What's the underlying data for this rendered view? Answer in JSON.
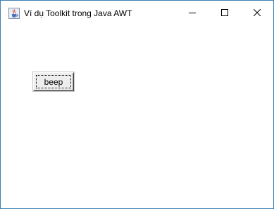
{
  "window": {
    "title": "Ví dụ Toolkit trong Java AWT",
    "icon": "java-coffee-cup-icon",
    "border_color": "#3c7fb1",
    "controls": [
      "minimize-icon",
      "maximize-icon",
      "close-icon"
    ]
  },
  "content": {
    "background": "#ffffff",
    "button": {
      "label": "beep",
      "focused": true
    }
  }
}
